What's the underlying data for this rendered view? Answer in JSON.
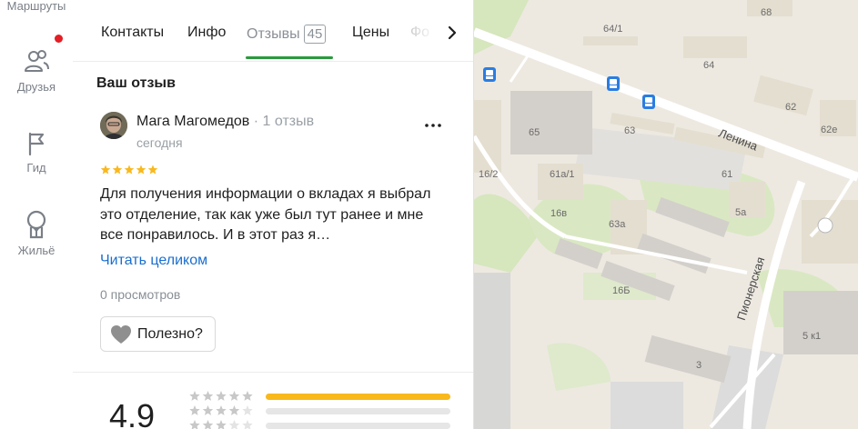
{
  "rail": {
    "routes_label": "Маршруты",
    "friends_label": "Друзья",
    "guide_label": "Гид",
    "housing_label": "Жильё"
  },
  "tabs": {
    "contacts": "Контакты",
    "info": "Инфо",
    "reviews": "Отзывы",
    "reviews_count": "45",
    "prices": "Цены",
    "partial": "Фо"
  },
  "review_section": {
    "title": "Ваш отзыв",
    "author": "Мага Магомедов",
    "author_meta": "1 отзыв",
    "date": "сегодня",
    "rating": 5,
    "text": "Для получения информации о вкладах я выбрал это отделение, так как уже был тут ранее и мне все понравилось. И в этот раз я…",
    "read_more": "Читать целиком",
    "views": "0 просмотров",
    "useful_label": "Полезно?"
  },
  "rating_summary": {
    "value": "4.9",
    "distribution": [
      {
        "stars": 5,
        "fraction": 1.0
      },
      {
        "stars": 4,
        "fraction": 0.0
      },
      {
        "stars": 3,
        "fraction": 0.0
      }
    ]
  },
  "map": {
    "street_lenina": "Ленина",
    "street_pionerskaya": "Пионерская",
    "house_numbers": [
      "68",
      "64/1",
      "64",
      "62",
      "62е",
      "65",
      "63",
      "61",
      "16/2",
      "61а/1",
      "16в",
      "63а",
      "5а",
      "16Б",
      "5 к1",
      "3"
    ],
    "colors": {
      "background": "#ede9e1",
      "building": "#e4ded0",
      "building_dark": "#d3d0cb",
      "green": "#d6e6bd",
      "road": "#ffffff",
      "industrial": "#dcdcdc",
      "bus_stop": "#2a7de1"
    }
  },
  "colors": {
    "accent_green": "#2a9a3c",
    "link_blue": "#1a6fcf",
    "star_yellow": "#f9b81c",
    "notification_red": "#e31e24"
  }
}
